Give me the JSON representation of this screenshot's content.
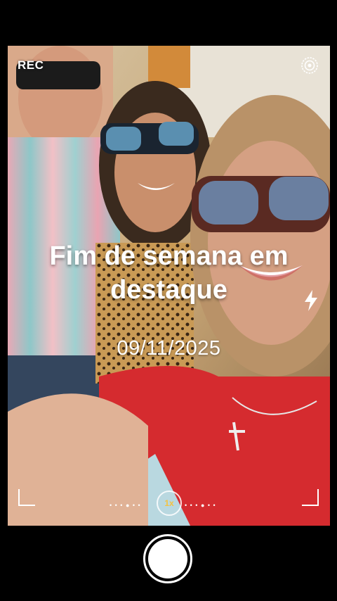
{
  "recording": {
    "label": "REC"
  },
  "overlay": {
    "title": "Fim de semana em destaque",
    "date": "09/11/2025"
  },
  "zoom": {
    "label": "1x"
  },
  "icons": {
    "settings": "settings-icon",
    "flash": "flash-icon",
    "shutter": "shutter-button"
  },
  "colors": {
    "background": "#000000",
    "overlay_text": "#ffffff",
    "zoom_accent": "#f4c242"
  }
}
